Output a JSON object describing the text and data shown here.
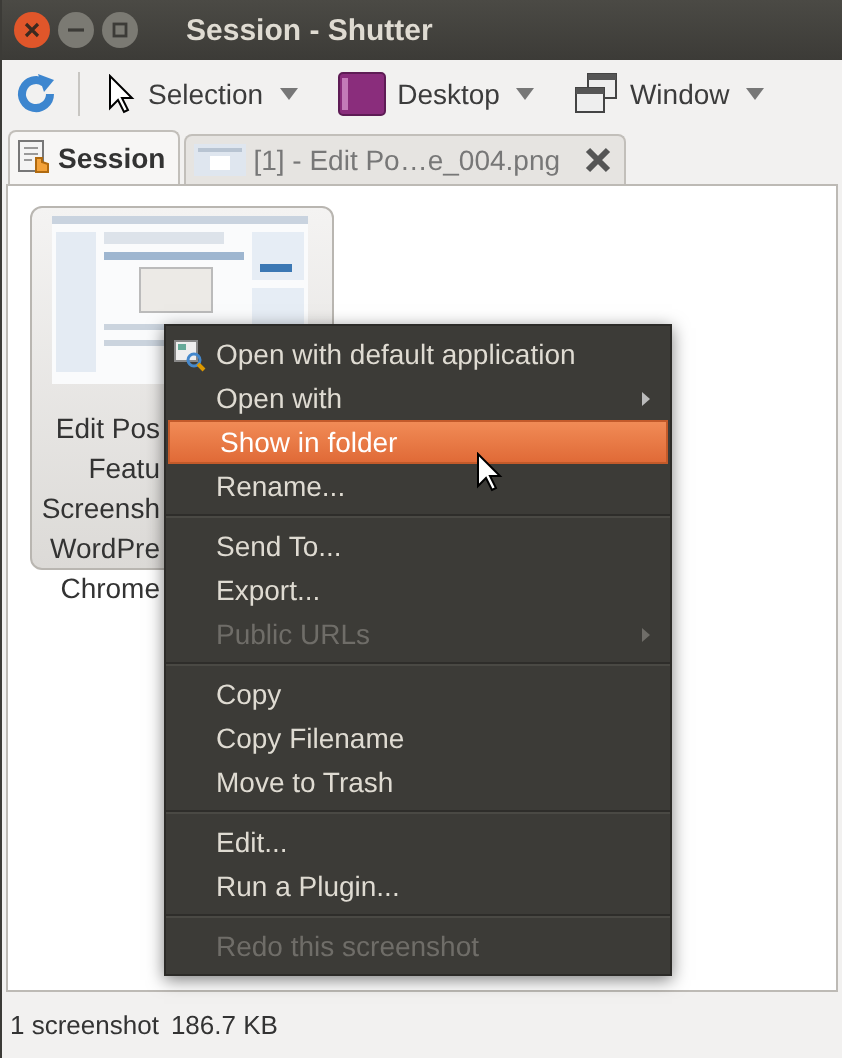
{
  "window": {
    "title": "Session - Shutter"
  },
  "toolbar": [
    {
      "kind": "refresh"
    },
    {
      "kind": "selection",
      "label": "Selection"
    },
    {
      "kind": "desktop",
      "label": "Desktop"
    },
    {
      "kind": "window",
      "label": "Window"
    }
  ],
  "tabs": [
    {
      "label": "Session",
      "kind": "session",
      "selected": true
    },
    {
      "label": "[1] - Edit Po…e_004.png",
      "kind": "file",
      "selected": false
    }
  ],
  "thumbnail": {
    "kind": "picture",
    "caption": [
      "Edit Pos",
      "Featu",
      "Screensh",
      "WordPre",
      "Chrome"
    ]
  },
  "context_menu": [
    {
      "kind": "item",
      "label": "Open with default application",
      "icon": true,
      "submenu": false,
      "disabled": false,
      "selected": false
    },
    {
      "kind": "item",
      "label": "Open with",
      "icon": false,
      "submenu": true,
      "disabled": false,
      "selected": false
    },
    {
      "kind": "item",
      "label": "Show in folder",
      "icon": false,
      "submenu": false,
      "disabled": false,
      "selected": true
    },
    {
      "kind": "item",
      "label": "Rename...",
      "icon": false,
      "submenu": false,
      "disabled": false,
      "selected": false
    },
    {
      "kind": "separator"
    },
    {
      "kind": "item",
      "label": "Send To...",
      "icon": false,
      "submenu": false,
      "disabled": false,
      "selected": false
    },
    {
      "kind": "item",
      "label": "Export...",
      "icon": false,
      "submenu": false,
      "disabled": false,
      "selected": false
    },
    {
      "kind": "item",
      "label": "Public URLs",
      "icon": false,
      "submenu": true,
      "disabled": true,
      "selected": false
    },
    {
      "kind": "separator"
    },
    {
      "kind": "item",
      "label": "Copy",
      "icon": false,
      "submenu": false,
      "disabled": false,
      "selected": false
    },
    {
      "kind": "item",
      "label": "Copy Filename",
      "icon": false,
      "submenu": false,
      "disabled": false,
      "selected": false
    },
    {
      "kind": "item",
      "label": "Move to Trash",
      "icon": false,
      "submenu": false,
      "disabled": false,
      "selected": false
    },
    {
      "kind": "separator"
    },
    {
      "kind": "item",
      "label": "Edit...",
      "icon": false,
      "submenu": false,
      "disabled": false,
      "selected": false
    },
    {
      "kind": "item",
      "label": "Run a Plugin...",
      "icon": false,
      "submenu": false,
      "disabled": false,
      "selected": false
    },
    {
      "kind": "separator"
    },
    {
      "kind": "item",
      "label": "Redo this screenshot",
      "icon": false,
      "submenu": false,
      "disabled": true,
      "selected": false
    }
  ],
  "status_bar": [
    "1 screenshot",
    "186.7 KB"
  ]
}
